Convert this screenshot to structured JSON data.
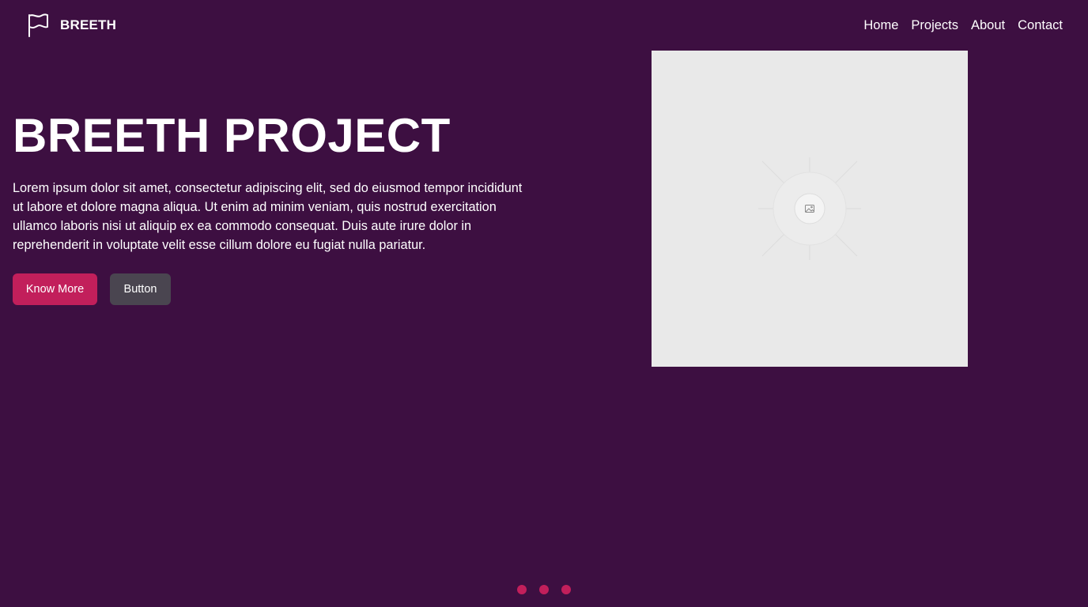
{
  "brand": {
    "name": "BREETH",
    "logo_icon": "flag-icon"
  },
  "nav": {
    "items": [
      {
        "label": "Home"
      },
      {
        "label": "Projects"
      },
      {
        "label": "About"
      },
      {
        "label": "Contact"
      }
    ]
  },
  "hero": {
    "title": "BREETH PROJECT",
    "description": "Lorem ipsum dolor sit amet, consectetur adipiscing elit, sed do eiusmod tempor incididunt ut labore et dolore magna aliqua. Ut enim ad minim veniam, quis nostrud exercitation ullamco laboris nisi ut aliquip ex ea commodo consequat. Duis aute irure dolor in reprehenderit in voluptate velit esse cillum dolore eu fugiat nulla pariatur.",
    "primary_button": "Know More",
    "secondary_button": "Button",
    "image_icon": "image-placeholder-icon"
  },
  "carousel": {
    "dot_count": 3
  },
  "colors": {
    "background": "#3d0f41",
    "accent": "#c21f5b",
    "secondary_button": "#4a4550",
    "placeholder": "#e9e9e9"
  }
}
